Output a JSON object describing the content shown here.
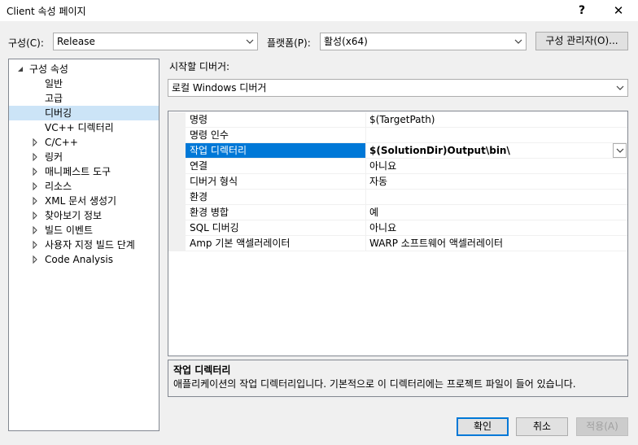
{
  "window": {
    "title": "Client 속성 페이지",
    "help_label": "?",
    "close_label": "✕"
  },
  "config": {
    "label": "구성(C):",
    "value": "Release"
  },
  "platform": {
    "label": "플랫폼(P):",
    "value": "활성(x64)"
  },
  "config_manager_label": "구성 관리자(O)...",
  "tree": {
    "root": "구성 속성",
    "items": [
      {
        "label": "일반",
        "expandable": false
      },
      {
        "label": "고급",
        "expandable": false
      },
      {
        "label": "디버깅",
        "expandable": false,
        "selected": true
      },
      {
        "label": "VC++ 디렉터리",
        "expandable": false
      },
      {
        "label": "C/C++",
        "expandable": true
      },
      {
        "label": "링커",
        "expandable": true
      },
      {
        "label": "매니페스트 도구",
        "expandable": true
      },
      {
        "label": "리소스",
        "expandable": true
      },
      {
        "label": "XML 문서 생성기",
        "expandable": true
      },
      {
        "label": "찾아보기 정보",
        "expandable": true
      },
      {
        "label": "빌드 이벤트",
        "expandable": true
      },
      {
        "label": "사용자 지정 빌드 단계",
        "expandable": true
      },
      {
        "label": "Code Analysis",
        "expandable": true
      }
    ]
  },
  "debugger": {
    "label": "시작할 디버거:",
    "value": "로컬 Windows 디버거"
  },
  "properties": [
    {
      "name": "명령",
      "value": "$(TargetPath)"
    },
    {
      "name": "명령 인수",
      "value": ""
    },
    {
      "name": "작업 디렉터리",
      "value": "$(SolutionDir)Output\\bin\\",
      "selected": true
    },
    {
      "name": "연결",
      "value": "아니요"
    },
    {
      "name": "디버거 형식",
      "value": "자동"
    },
    {
      "name": "환경",
      "value": ""
    },
    {
      "name": "환경 병합",
      "value": "예"
    },
    {
      "name": "SQL 디버깅",
      "value": "아니요"
    },
    {
      "name": "Amp 기본 액셀러레이터",
      "value": "WARP 소프트웨어 액셀러레이터"
    }
  ],
  "description": {
    "title": "작업 디렉터리",
    "text": "애플리케이션의 작업 디렉터리입니다. 기본적으로 이 디렉터리에는 프로젝트 파일이 들어 있습니다."
  },
  "buttons": {
    "ok": "확인",
    "cancel": "취소",
    "apply": "적용(A)"
  },
  "colors": {
    "selection": "#0078d7",
    "tree_selection": "#cce4f7",
    "dialog_bg": "#f0f0f0"
  }
}
